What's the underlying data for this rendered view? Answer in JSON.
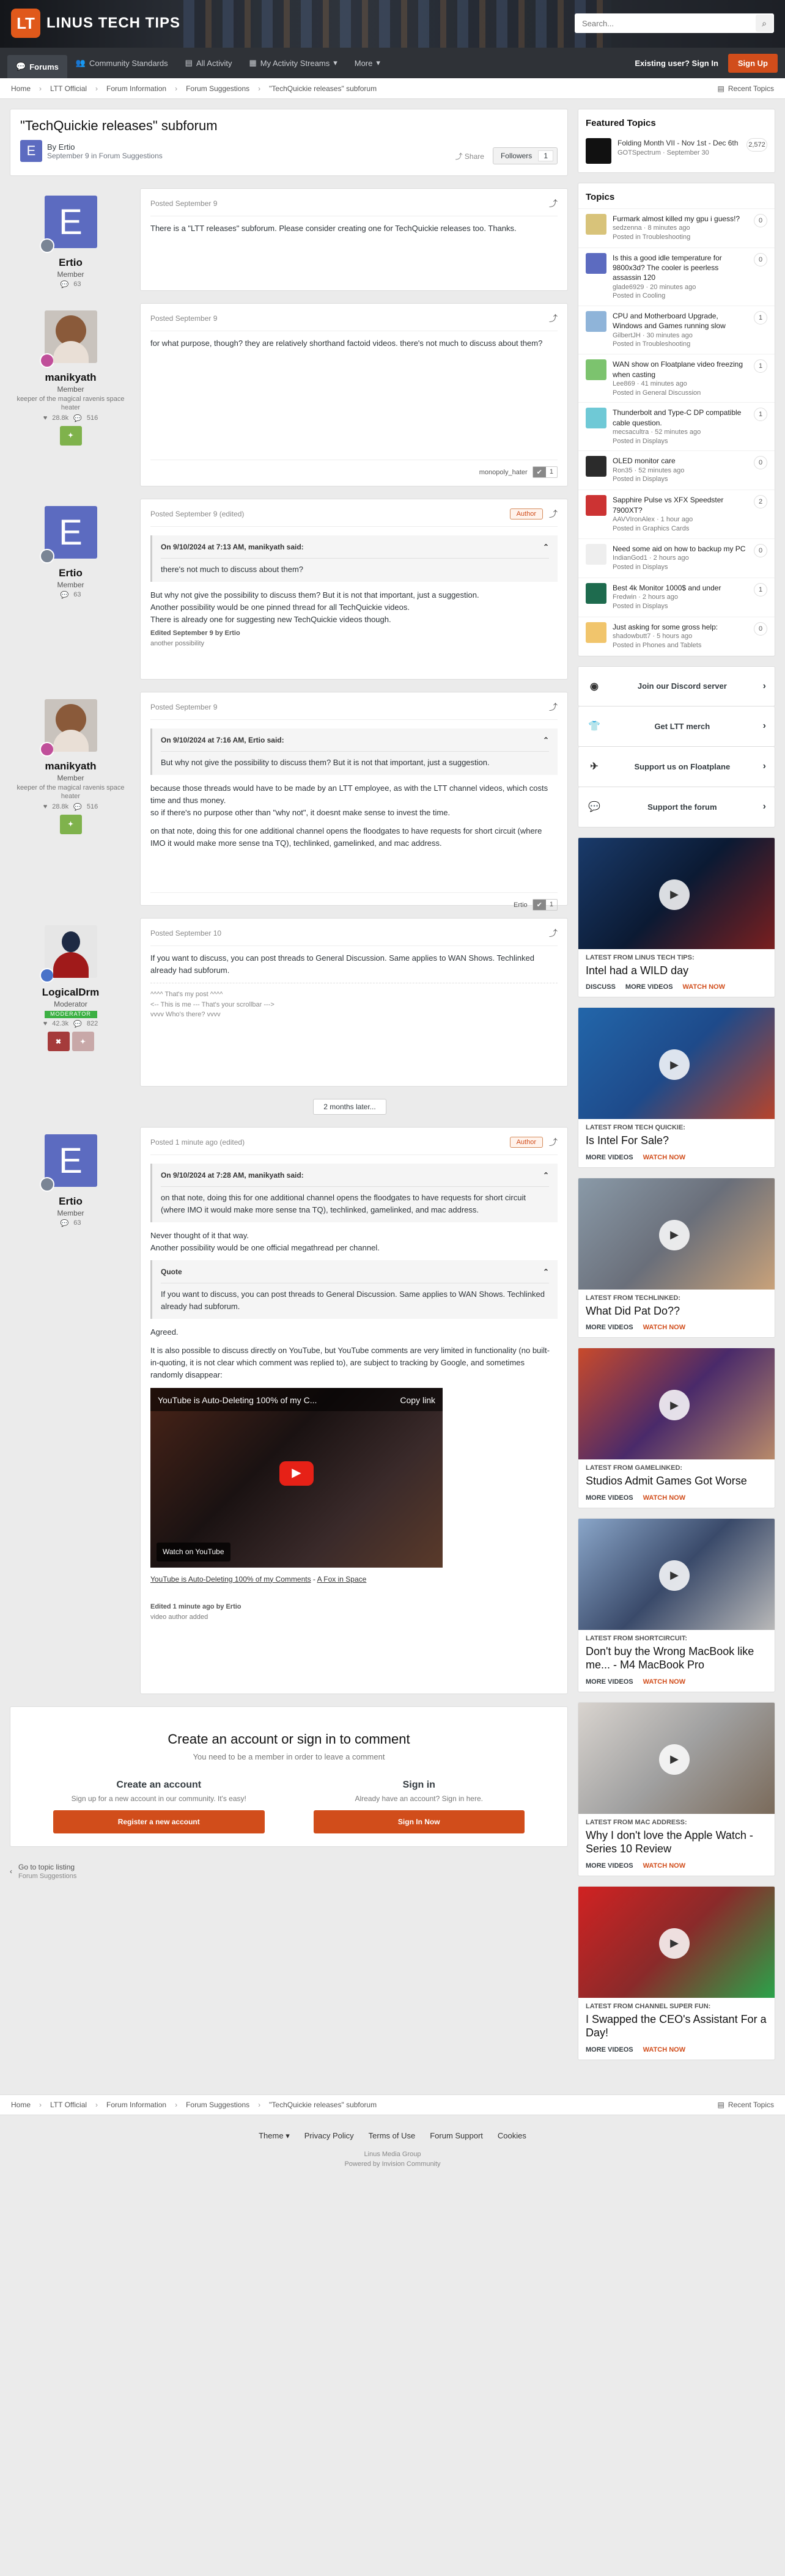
{
  "header": {
    "logo_text": "LINUS TECH TIPS",
    "logo_glyph": "LT",
    "search_placeholder": "Search..."
  },
  "nav": {
    "items": [
      "Forums",
      "Community Standards",
      "All Activity",
      "My Activity Streams",
      "More"
    ],
    "signin": "Existing user? Sign In",
    "signup": "Sign Up"
  },
  "crumbs": [
    "Home",
    "LTT Official",
    "Forum Information",
    "Forum Suggestions",
    "\"TechQuickie releases\" subforum"
  ],
  "recent": "Recent Topics",
  "topic": {
    "title": "\"TechQuickie releases\" subforum",
    "by": "By Ertio",
    "meta": "September 9 in Forum Suggestions",
    "share": "Share",
    "followers": "Followers",
    "followers_count": "1"
  },
  "posts": [
    {
      "author": "Ertio",
      "initial": "E",
      "title": "Member",
      "stat": "63",
      "date": "Posted September 9",
      "body": [
        "There is a \"LTT releases\" subforum. Please consider creating one for TechQuickie releases too. Thanks."
      ]
    },
    {
      "author": "manikyath",
      "title": "Member",
      "extra": "keeper of the magical ravenis space heater",
      "stats": [
        "28.8k",
        "516"
      ],
      "date": "Posted September 9",
      "body": [
        "for what purpose, though? they are relatively shorthand factoid videos. there's not much to discuss about them?"
      ],
      "liker": "monopoly_hater",
      "likes": "1"
    },
    {
      "author": "Ertio",
      "initial": "E",
      "title": "Member",
      "stat": "63",
      "date": "Posted September 9 (edited)",
      "author_badge": "Author",
      "quote_head": "On 9/10/2024 at 7:13 AM, manikyath said:",
      "quote": "there's not much to discuss about them?",
      "body": [
        "But why not give the possibility to discuss them? But it is not that important, just a suggestion.",
        "Another possibility would be one pinned thread for all TechQuickie videos.",
        "There is already one for suggesting new TechQuickie videos though."
      ],
      "edited": "Edited September 9 by Ertio",
      "edited_reason": "another possibility"
    },
    {
      "author": "manikyath",
      "title": "Member",
      "extra": "keeper of the magical ravenis space heater",
      "stats": [
        "28.8k",
        "516"
      ],
      "date": "Posted September 9",
      "quote_head": "On 9/10/2024 at 7:16 AM, Ertio said:",
      "quote": "But why not give the possibility to discuss them? But it is not that important, just a suggestion.",
      "body": [
        "because those threads would have to be made by an LTT employee, as with the LTT channel videos, which costs time and thus money.",
        "so if there's no purpose other than \"why not\", it doesnt make sense to invest the time.",
        "on that note, doing this for one additional channel opens the floodgates to have requests for short circuit (where IMO it would make more sense tna TQ), techlinked, gamelinked, and mac address."
      ],
      "liker": "Ertio",
      "likes": "1"
    },
    {
      "author": "LogicalDrm",
      "title": "Moderator",
      "modbar": "MODERATOR",
      "stats": [
        "42.3k",
        "822"
      ],
      "date": "Posted September 10",
      "body": [
        "If you want to discuss, you can post threads to General Discussion. Same applies to WAN Shows. Techlinked already had subforum."
      ],
      "sig": [
        "^^^^ That's my post ^^^^",
        "<-- This is me --- That's your scrollbar --->",
        "vvvv Who's there? vvvv"
      ]
    },
    {
      "author": "Ertio",
      "initial": "E",
      "title": "Member",
      "stat": "63",
      "date": "Posted 1 minute ago (edited)",
      "author_badge": "Author",
      "quote_head": "On 9/10/2024 at 7:28 AM, manikyath said:",
      "quote": "on that note, doing this for one additional channel opens the floodgates to have requests for short circuit (where IMO it would make more sense tna TQ), techlinked, gamelinked, and mac address.",
      "body": [
        "Never thought of it that way.",
        "Another possibility would be one official megathread per channel."
      ],
      "quote2_head": "Quote",
      "quote2": "If you want to discuss, you can post threads to General Discussion. Same applies to WAN Shows. Techlinked already had subforum.",
      "body2": [
        "Agreed.",
        "It is also possible to discuss directly on YouTube, but YouTube comments are very limited in functionality (no built-in-quoting, it is not clear which comment was replied to), are subject to tracking by Google, and sometimes randomly disappear:"
      ],
      "video_title": "YouTube is Auto-Deleting 100% of my C...",
      "video_copy": "Copy link",
      "video_watch": "Watch on YouTube",
      "video_link": "YouTube is Auto-Deleting 100% of my Comments",
      "video_channel": "A Fox in Space",
      "edited": "Edited 1 minute ago by Ertio",
      "edited_reason": "video author added"
    }
  ],
  "later": "2 months later...",
  "signin": {
    "title": "Create an account or sign in to comment",
    "sub": "You need to be a member in order to leave a comment",
    "create_h": "Create an account",
    "create_d": "Sign up for a new account in our community. It's easy!",
    "create_b": "Register a new account",
    "sign_h": "Sign in",
    "sign_d": "Already have an account? Sign in here.",
    "sign_b": "Sign In Now"
  },
  "goto": {
    "label": "Go to topic listing",
    "sub": "Forum Suggestions"
  },
  "featured": {
    "title": "Featured Topics",
    "item": "Folding Month VII - Nov 1st - Dec 6th",
    "meta": "GOTSpectrum · September 30",
    "count": "2,572"
  },
  "topics": {
    "title": "Topics",
    "items": [
      {
        "t": "Furmark almost killed my gpu i guess!?",
        "m": "sedzenna · 8 minutes ago",
        "f": "Posted in Troubleshooting",
        "c": "0"
      },
      {
        "t": "Is this a good idle temperature for 9800x3d? The cooler is peerless assassin 120",
        "m": "glade6929 · 20 minutes ago",
        "f": "Posted in Cooling",
        "c": "0"
      },
      {
        "t": "CPU and Motherboard Upgrade, Windows and Games running slow",
        "m": "GilbertJH · 30 minutes ago",
        "f": "Posted in Troubleshooting",
        "c": "1"
      },
      {
        "t": "WAN show on Floatplane video freezing when casting",
        "m": "Lee869 · 41 minutes ago",
        "f": "Posted in General Discussion",
        "c": "1"
      },
      {
        "t": "Thunderbolt and Type-C DP compatible cable question.",
        "m": "mecsacultra · 52 minutes ago",
        "f": "Posted in Displays",
        "c": "1"
      },
      {
        "t": "OLED monitor care",
        "m": "Ron35 · 52 minutes ago",
        "f": "Posted in Displays",
        "c": "0"
      },
      {
        "t": "Sapphire Pulse vs XFX Speedster 7900XT?",
        "m": "AAVVIronAlex · 1 hour ago",
        "f": "Posted in Graphics Cards",
        "c": "2"
      },
      {
        "t": "Need some aid on how to backup my PC",
        "m": "IndianGod1 · 2 hours ago",
        "f": "Posted in Displays",
        "c": "0"
      },
      {
        "t": "Best 4k Monitor 1000$ and under",
        "m": "Fredwin · 2 hours ago",
        "f": "Posted in Displays",
        "c": "1"
      },
      {
        "t": "Just asking for some gross help:",
        "m": "shadowbutt7 · 5 hours ago",
        "f": "Posted in Phones and Tablets",
        "c": "0"
      }
    ]
  },
  "links": [
    "Join our Discord server",
    "Get LTT merch",
    "Support us on Floatplane",
    "Support the forum"
  ],
  "videos": [
    {
      "from": "Latest from Linus Tech Tips:",
      "title": "Intel had a WILD day",
      "links": [
        "DISCUSS",
        "MORE VIDEOS",
        "WATCH NOW"
      ]
    },
    {
      "from": "Latest from Tech Quickie:",
      "title": "Is Intel For Sale?",
      "links": [
        "MORE VIDEOS",
        "WATCH NOW"
      ]
    },
    {
      "from": "Latest from TechLinked:",
      "title": "What Did Pat Do??",
      "links": [
        "MORE VIDEOS",
        "WATCH NOW"
      ]
    },
    {
      "from": "Latest from GameLinked:",
      "title": "Studios Admit Games Got Worse",
      "links": [
        "MORE VIDEOS",
        "WATCH NOW"
      ]
    },
    {
      "from": "Latest from ShortCircuit:",
      "title": "Don't buy the Wrong MacBook like me... - M4 MacBook Pro",
      "links": [
        "MORE VIDEOS",
        "WATCH NOW"
      ]
    },
    {
      "from": "Latest from Mac Address:",
      "title": "Why I don't love the Apple Watch - Series 10 Review",
      "links": [
        "MORE VIDEOS",
        "WATCH NOW"
      ]
    },
    {
      "from": "Latest from Channel Super Fun:",
      "title": "I Swapped the CEO's Assistant For a Day!",
      "links": [
        "MORE VIDEOS",
        "WATCH NOW"
      ]
    }
  ],
  "footer": {
    "links": [
      "Theme",
      "Privacy Policy",
      "Terms of Use",
      "Forum Support",
      "Cookies"
    ],
    "company": "Linus Media Group",
    "powered": "Powered by Invision Community"
  }
}
